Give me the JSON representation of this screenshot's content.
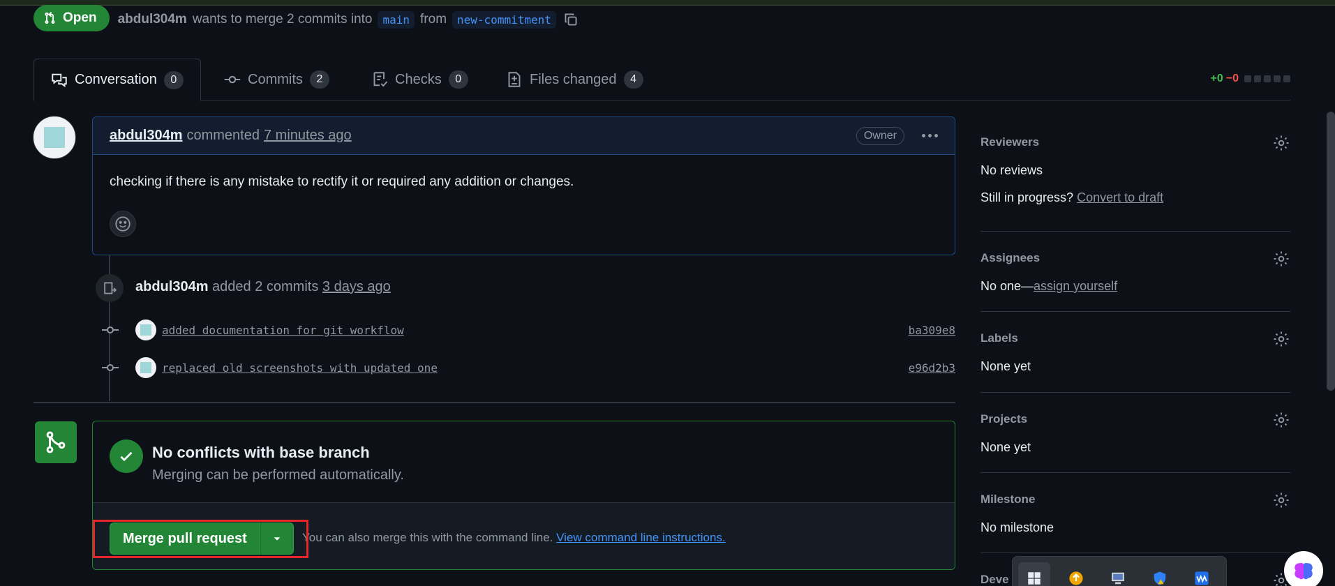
{
  "header": {
    "state": "Open",
    "author": "abdul304m",
    "text_wants": "wants to merge 2 commits into",
    "base_branch": "main",
    "text_from": "from",
    "head_branch": "new-commitment"
  },
  "tabs": [
    {
      "label": "Conversation",
      "count": "0"
    },
    {
      "label": "Commits",
      "count": "2"
    },
    {
      "label": "Checks",
      "count": "0"
    },
    {
      "label": "Files changed",
      "count": "4"
    }
  ],
  "diffstat": {
    "added": "+0",
    "removed": "−0"
  },
  "comment": {
    "author": "abdul304m",
    "verb": "commented",
    "time": "7 minutes ago",
    "badge": "Owner",
    "body": "checking if there is any mistake to rectify it or required any addition or changes."
  },
  "commits_event": {
    "author": "abdul304m",
    "text": "added 2 commits",
    "time": "3 days ago",
    "commits": [
      {
        "message": "added documentation for git workflow",
        "sha": "ba309e8"
      },
      {
        "message": "replaced old screenshots with updated one",
        "sha": "e96d2b3"
      }
    ]
  },
  "merge": {
    "title": "No conflicts with base branch",
    "subtitle": "Merging can be performed automatically.",
    "button": "Merge pull request",
    "hint": "You can also merge this with the command line.",
    "hint_link": "View command line instructions."
  },
  "sidebar": {
    "reviewers": {
      "title": "Reviewers",
      "value": "No reviews",
      "progress_text": "Still in progress?",
      "progress_link": "Convert to draft"
    },
    "assignees": {
      "title": "Assignees",
      "value": "No one—",
      "link": "assign yourself"
    },
    "labels": {
      "title": "Labels",
      "value": "None yet"
    },
    "projects": {
      "title": "Projects",
      "value": "None yet"
    },
    "milestone": {
      "title": "Milestone",
      "value": "No milestone"
    },
    "development": {
      "title": "Deve"
    }
  },
  "colors": {
    "accent_green": "#238636",
    "link_blue": "#4493f8",
    "highlight_red": "#e5252a"
  }
}
